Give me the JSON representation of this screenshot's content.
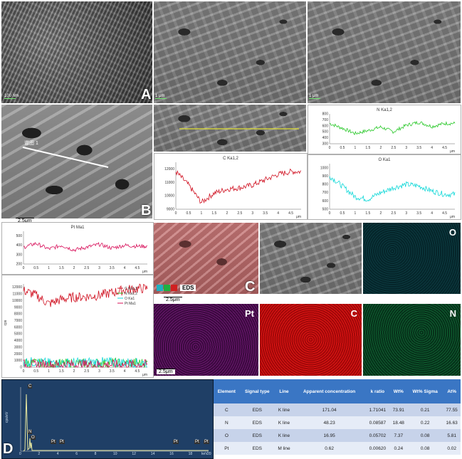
{
  "panels": {
    "A": {
      "letter": "A",
      "scale1": "100 nm",
      "scale2": "1 μm",
      "scale3": "1 μm"
    },
    "B": {
      "letter": "B",
      "line_label": "谱图 1",
      "scale": "2.5μm"
    },
    "C": {
      "letter": "C",
      "eds_label": "EDS",
      "scale": "2.5μm",
      "maps": [
        {
          "element": "O",
          "color": "#13888a"
        },
        {
          "element": "Pt",
          "color": "#8a1b8f"
        },
        {
          "element": "C",
          "color": "#d41010"
        },
        {
          "element": "N",
          "color": "#128a3e"
        }
      ]
    },
    "D": {
      "letter": "D",
      "ylabel": "cps/eV",
      "peaks": [
        "C",
        "N",
        "O",
        "Pt",
        "Pt",
        "Pt",
        "Pt",
        "Pt"
      ],
      "ticks": [
        "0",
        "2",
        "4",
        "6",
        "8",
        "10",
        "12",
        "14",
        "16",
        "18",
        "20"
      ],
      "unit": "keV"
    }
  },
  "chart_data": [
    {
      "type": "line",
      "title": "N Ka1,2",
      "color": "#28c828",
      "x": [
        0,
        0.5,
        1,
        1.5,
        2,
        2.5,
        3,
        3.5,
        4,
        4.5
      ],
      "yticks": [
        "800",
        "700",
        "600",
        "500",
        "400",
        "300"
      ],
      "ylim": [
        300,
        800
      ],
      "values": [
        640,
        560,
        470,
        520,
        580,
        500,
        610,
        660,
        590,
        640
      ],
      "xlabel": "μm"
    },
    {
      "type": "line",
      "title": "C Ka1,2",
      "color": "#d01020",
      "x": [
        0,
        0.5,
        1,
        1.5,
        2,
        2.5,
        3,
        3.5,
        4,
        4.5
      ],
      "yticks": [
        "12000",
        "11000",
        "10000",
        "9000"
      ],
      "ylim": [
        9000,
        12500
      ],
      "values": [
        11800,
        10800,
        9500,
        10200,
        10500,
        10600,
        10800,
        11200,
        11600,
        11800
      ],
      "xlabel": "μm"
    },
    {
      "type": "line",
      "title": "O Ka1",
      "color": "#10d8d8",
      "x": [
        0,
        0.5,
        1,
        1.5,
        2,
        2.5,
        3,
        3.5,
        4,
        4.5
      ],
      "yticks": [
        "1000",
        "900",
        "800",
        "700",
        "600",
        "500"
      ],
      "ylim": [
        500,
        1050
      ],
      "values": [
        900,
        780,
        650,
        620,
        700,
        760,
        800,
        780,
        720,
        680
      ],
      "xlabel": "μm"
    },
    {
      "type": "line",
      "title": "Pt Ma1",
      "color": "#d8105a",
      "x": [
        0,
        0.5,
        1,
        1.5,
        2,
        2.5,
        3,
        3.5,
        4,
        4.5
      ],
      "yticks": [
        "500",
        "400",
        "300",
        "200"
      ],
      "ylim": [
        200,
        550
      ],
      "values": [
        380,
        420,
        360,
        400,
        350,
        380,
        410,
        370,
        400,
        390
      ],
      "xlabel": "μm"
    },
    {
      "type": "line",
      "title": "",
      "ylabel": "cps",
      "yticks": [
        "12000",
        "11000",
        "10000",
        "9000",
        "8000",
        "7000",
        "6000",
        "5000",
        "4000",
        "3000",
        "2000",
        "1000",
        "0"
      ],
      "ylim": [
        0,
        12500
      ],
      "x": [
        0,
        0.5,
        1,
        1.5,
        2,
        2.5,
        3,
        3.5,
        4,
        4.5
      ],
      "series": [
        {
          "name": "C Ka1,2",
          "color": "#d01020",
          "values": [
            11500,
            10800,
            9500,
            10200,
            10500,
            10600,
            10800,
            11200,
            11600,
            11800
          ]
        },
        {
          "name": "N Ka1,2",
          "color": "#28c828",
          "values": [
            650,
            580,
            500,
            520,
            600,
            540,
            620,
            660,
            600,
            640
          ]
        },
        {
          "name": "O Ka1",
          "color": "#10d8d8",
          "values": [
            850,
            760,
            620,
            600,
            680,
            740,
            780,
            760,
            700,
            660
          ]
        },
        {
          "name": "Pt Ma1",
          "color": "#d8105a",
          "values": [
            400,
            380,
            360,
            390,
            370,
            400,
            380,
            360,
            390,
            400
          ]
        }
      ],
      "xlabel": "μm"
    }
  ],
  "xticks": [
    "0",
    "0.5",
    "1",
    "1.5",
    "2",
    "2.5",
    "3",
    "3.5",
    "4",
    "4.5"
  ],
  "table": {
    "headers": [
      "Element",
      "Signal type",
      "Line",
      "Apparent concentration",
      "k ratio",
      "Wt%",
      "Wt% Sigma",
      "At%"
    ],
    "rows": [
      [
        "C",
        "EDS",
        "K line",
        "171.04",
        "1.71041",
        "73.91",
        "0.21",
        "77.55"
      ],
      [
        "N",
        "EDS",
        "K line",
        "48.23",
        "0.08587",
        "18.48",
        "0.22",
        "16.63"
      ],
      [
        "O",
        "EDS",
        "K line",
        "16.95",
        "0.05702",
        "7.37",
        "0.08",
        "5.81"
      ],
      [
        "Pt",
        "EDS",
        "M line",
        "0.62",
        "0.00620",
        "0.24",
        "0.08",
        "0.02"
      ]
    ]
  }
}
